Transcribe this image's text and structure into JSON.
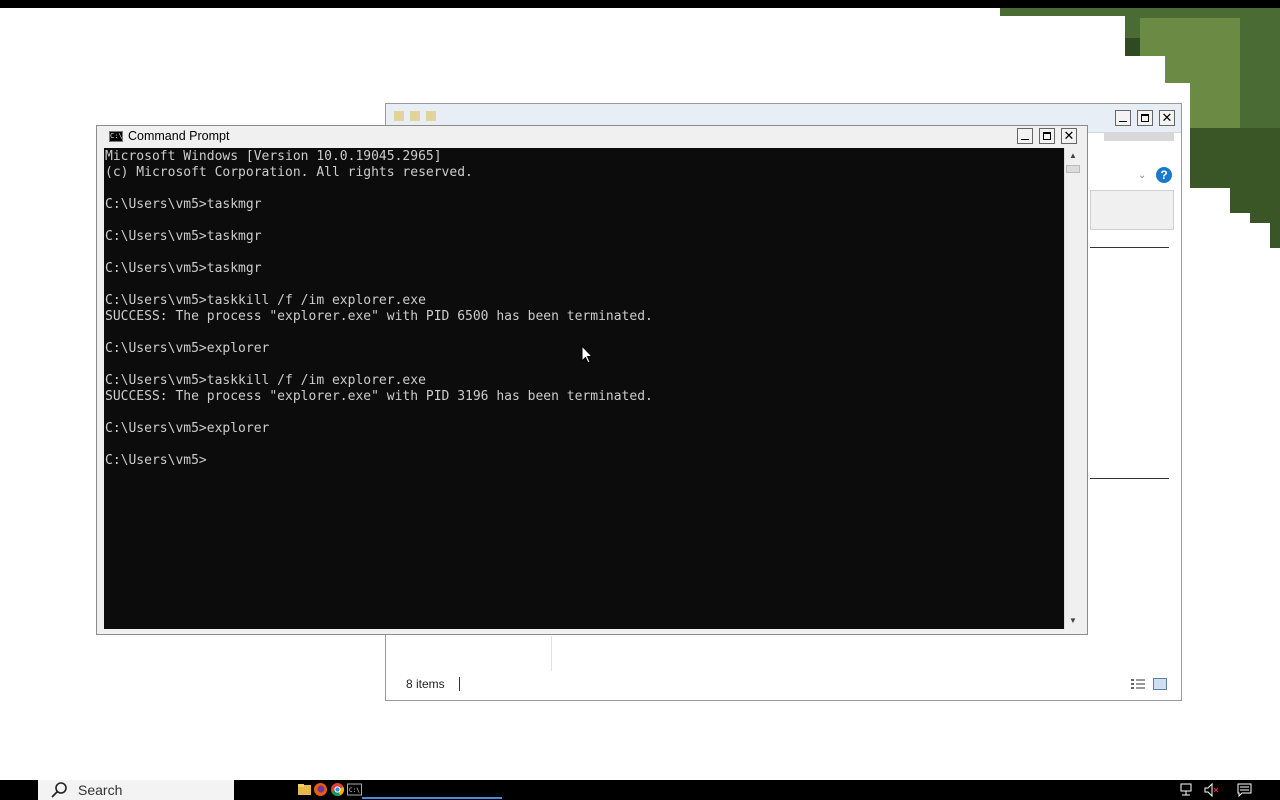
{
  "cmd_window": {
    "title": "Command Prompt",
    "icon_label": "C:\\",
    "lines": [
      "Microsoft Windows [Version 10.0.19045.2965]",
      "(c) Microsoft Corporation. All rights reserved.",
      "",
      "C:\\Users\\vm5>taskmgr",
      "",
      "C:\\Users\\vm5>taskmgr",
      "",
      "C:\\Users\\vm5>taskmgr",
      "",
      "C:\\Users\\vm5>taskkill /f /im explorer.exe",
      "SUCCESS: The process \"explorer.exe\" with PID 6500 has been terminated.",
      "",
      "C:\\Users\\vm5>explorer",
      "",
      "C:\\Users\\vm5>taskkill /f /im explorer.exe",
      "SUCCESS: The process \"explorer.exe\" with PID 3196 has been terminated.",
      "",
      "C:\\Users\\vm5>explorer",
      "",
      "C:\\Users\\vm5>"
    ],
    "console_bg": "#0c0c0c",
    "console_fg": "#cccccc"
  },
  "explorer_window": {
    "status_text": "8 items",
    "help_label": "?"
  },
  "taskbar": {
    "search_label": "Search",
    "accent": "#4a8cd8"
  }
}
